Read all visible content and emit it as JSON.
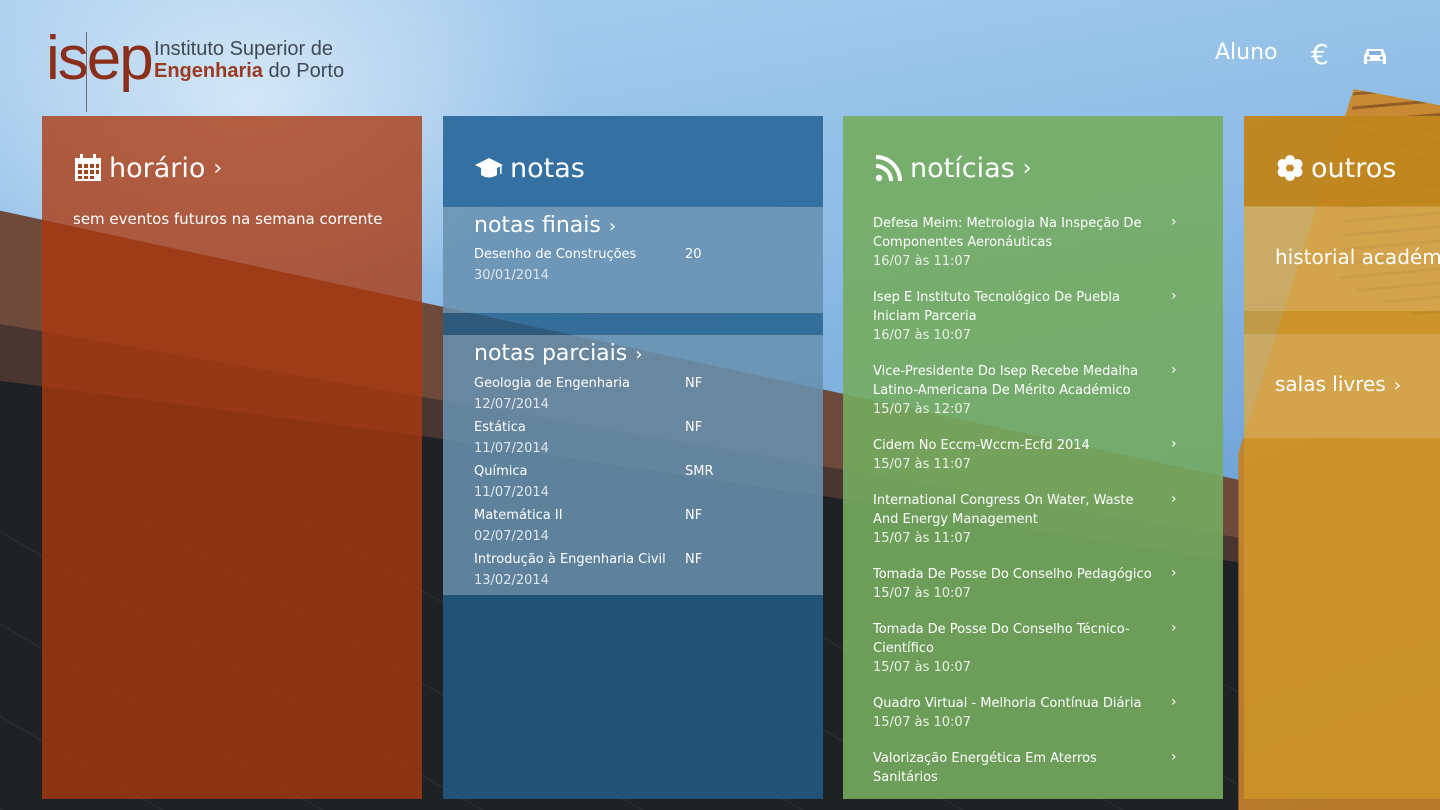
{
  "logo": {
    "mark": "isep",
    "line1": "Instituto Superior de",
    "line2_bold": "Engenharia",
    "line2_rest": " do Porto"
  },
  "header": {
    "user_label": "Aluno",
    "euro_symbol": "€",
    "icons": [
      "euro-icon",
      "car-icon"
    ]
  },
  "horario": {
    "title": "horário",
    "chevron": "›",
    "empty_text": "sem eventos futuros na semana corrente"
  },
  "notas": {
    "title": "notas",
    "finais": {
      "title": "notas finais",
      "items": [
        {
          "name": "Desenho de Construções",
          "grade": "20",
          "date": "30/01/2014"
        }
      ]
    },
    "parciais": {
      "title": "notas parciais",
      "items": [
        {
          "name": "Geologia de Engenharia",
          "grade": "NF",
          "date": "12/07/2014"
        },
        {
          "name": "Estática",
          "grade": "NF",
          "date": "11/07/2014"
        },
        {
          "name": "Química",
          "grade": "SMR",
          "date": "11/07/2014"
        },
        {
          "name": "Matemática II",
          "grade": "NF",
          "date": "02/07/2014"
        },
        {
          "name": "Introdução à Engenharia Civil",
          "grade": "NF",
          "date": "13/02/2014"
        }
      ]
    }
  },
  "noticias": {
    "title": "notícias",
    "items": [
      {
        "title": "Defesa Meim: Metrologia Na Inspeção De Componentes Aeronáuticas",
        "date": "16/07 às 11:07"
      },
      {
        "title": "Isep E Instituto Tecnológico De Puebla Iniciam Parceria",
        "date": "16/07 às 10:07"
      },
      {
        "title": "Vice-Presidente Do Isep Recebe Medalha Latino-Americana De Mérito Académico",
        "date": "15/07 às 12:07"
      },
      {
        "title": "Cidem No Eccm-Wccm-Ecfd 2014",
        "date": "15/07 às 11:07"
      },
      {
        "title": "International Congress On Water, Waste And Energy Management",
        "date": "15/07 às 11:07"
      },
      {
        "title": "Tomada De Posse Do Conselho Pedagógico",
        "date": "15/07 às 10:07"
      },
      {
        "title": "Tomada De Posse Do Conselho Técnico-Científico",
        "date": "15/07 às 10:07"
      },
      {
        "title": "Quadro Virtual - Melhoria Contínua Diária",
        "date": "15/07 às 10:07"
      },
      {
        "title": "Valorização Energética Em Aterros Sanitários",
        "date": ""
      }
    ]
  },
  "outros": {
    "title": "outros",
    "items": [
      {
        "label": "historial académico"
      },
      {
        "label": "salas livres"
      }
    ]
  },
  "colors": {
    "horario": "#ac380e",
    "notas": "#225e8a",
    "noticias": "#74ac60",
    "outros": "#cd9628",
    "logo_red": "#8b2f1c"
  }
}
